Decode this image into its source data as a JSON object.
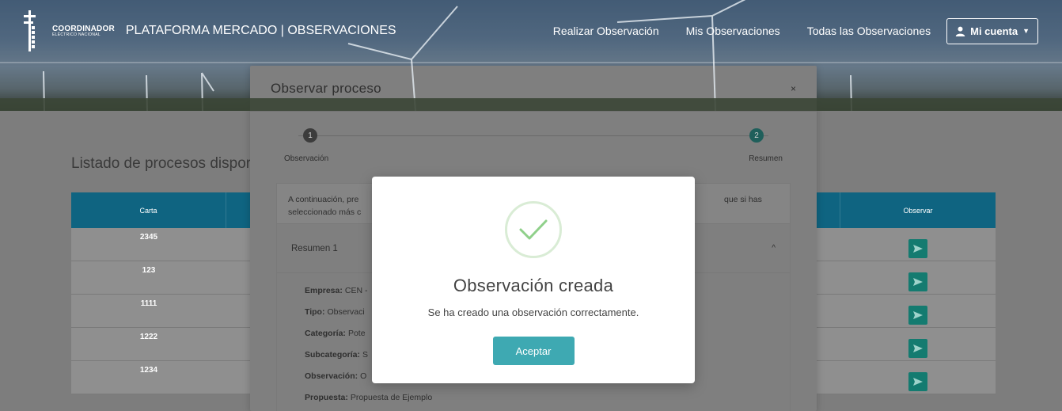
{
  "navbar": {
    "logo_main": "COORDINADOR",
    "logo_sub": "ELÉCTRICO NACIONAL",
    "title": "PLATAFORMA MERCADO | OBSERVACIONES",
    "links": [
      "Realizar Observación",
      "Mis Observaciones",
      "Todas las Observaciones"
    ],
    "account_label": "Mi cuenta"
  },
  "page": {
    "title": "Listado de procesos dispor",
    "table": {
      "headers": [
        "Carta",
        "",
        "Observar"
      ],
      "rows": [
        "2345",
        "123",
        "1111",
        "1222",
        "1234"
      ]
    }
  },
  "modal_process": {
    "title": "Observar proceso",
    "close": "×",
    "steps": [
      {
        "number": "1",
        "label": "Observación"
      },
      {
        "number": "2",
        "label": "Resumen"
      }
    ],
    "info_line1": "A continuación, pre",
    "info_line2": "seleccionado más c",
    "info_right": "que si has",
    "summary_title": "Resumen 1",
    "fields": [
      {
        "label": "Empresa:",
        "value": "CEN -"
      },
      {
        "label": "Tipo:",
        "value": "Observaci"
      },
      {
        "label": "Categoría:",
        "value": "Pote"
      },
      {
        "label": "Subcategoría:",
        "value": "S"
      },
      {
        "label": "Observación:",
        "value": "O"
      },
      {
        "label": "Propuesta:",
        "value": "Propuesta de Ejemplo"
      }
    ]
  },
  "modal_success": {
    "title": "Observación creada",
    "message": "Se ha creado una observación correctamente.",
    "accept_label": "Aceptar"
  },
  "colors": {
    "table_header": "#0f6481",
    "observe_button": "#147b70",
    "accept_button": "#3ea9b2",
    "check": "#8fd08a"
  }
}
